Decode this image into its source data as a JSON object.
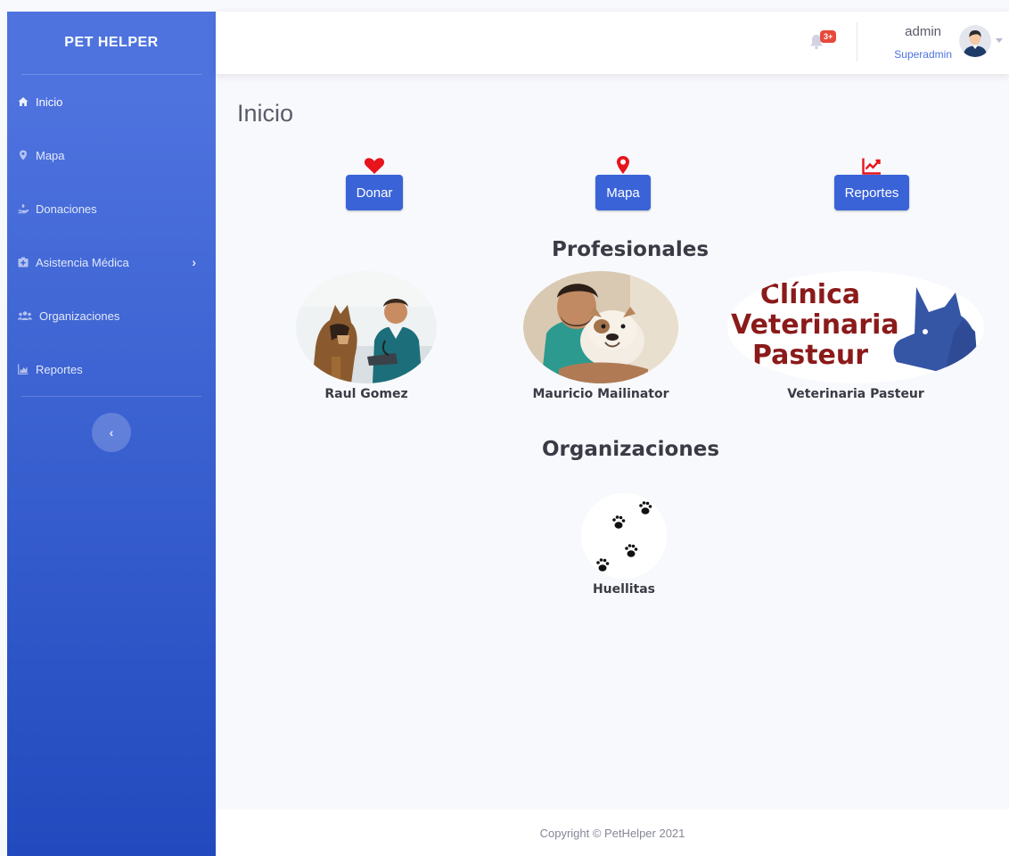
{
  "brand": "PET HELPER",
  "sidebar": {
    "items": [
      {
        "label": "Inicio",
        "icon": "home-icon"
      },
      {
        "label": "Mapa",
        "icon": "map-marker-icon"
      },
      {
        "label": "Donaciones",
        "icon": "hand-holding-icon"
      },
      {
        "label": "Asistencia Médica",
        "icon": "clinic-icon"
      },
      {
        "label": "Organizaciones",
        "icon": "users-icon"
      },
      {
        "label": "Reportes",
        "icon": "chart-area-icon"
      }
    ],
    "toggle_label": "‹"
  },
  "topbar": {
    "alerts_badge": "3+",
    "user_name": "admin",
    "user_role": "Superadmin"
  },
  "main": {
    "title": "Inicio",
    "actions": [
      {
        "label": "Donar",
        "icon": "heart-icon"
      },
      {
        "label": "Mapa",
        "icon": "map-marker-icon"
      },
      {
        "label": "Reportes",
        "icon": "chart-line-icon"
      }
    ],
    "profesionales_title": "Profesionales",
    "profesionales": [
      {
        "name": "Raul Gomez"
      },
      {
        "name": "Mauricio Mailinator"
      },
      {
        "name": "Veterinaria Pasteur",
        "logo_text": [
          "Clínica",
          "Veterinaria",
          "Pasteur"
        ]
      }
    ],
    "organizaciones_title": "Organizaciones",
    "organizaciones": [
      {
        "name": "Huellitas"
      }
    ]
  },
  "footer": {
    "copyright": "Copyright © PetHelper 2021"
  },
  "colors": {
    "sidebar_top": "#4e73df",
    "sidebar_bottom": "#224abe",
    "button": "#3a63d8",
    "icon_red": "#e8141b",
    "badge": "#e74a3b",
    "logo_red": "#8b1a1a",
    "logo_blue": "#3555a5"
  }
}
